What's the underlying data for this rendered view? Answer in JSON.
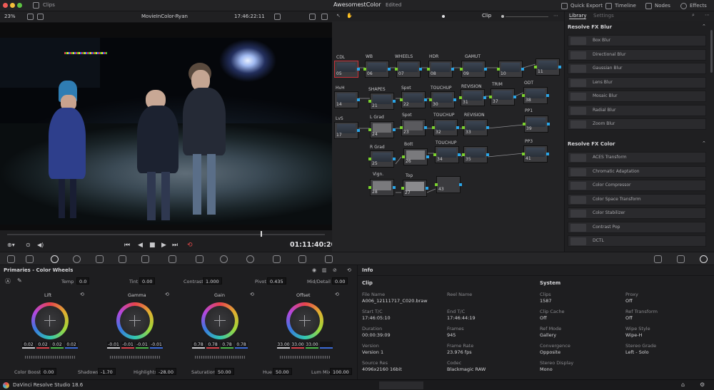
{
  "window": {
    "breadcrumb": "Clips",
    "project_title": "AwesomestColor",
    "project_status": "Edited",
    "top_buttons": {
      "quick_export": "Quick Export",
      "timeline": "Timeline",
      "nodes": "Nodes",
      "effects": "Effects"
    }
  },
  "viewer": {
    "zoom": "23%",
    "clip_name": "MovieInColor-Ryan",
    "timecode_top": "17:46:22:11",
    "timecode": "01:11:40:20"
  },
  "node_graph": {
    "mode": "Clip",
    "labels": [
      "CDL",
      "WB",
      "WHEELS",
      "HDR",
      "GAMUT",
      "HvH",
      "SHAPES",
      "Spot",
      "TOUCHUP",
      "REVISION",
      "TRIM",
      "ODT",
      "LvS",
      "L Grad",
      "Spot",
      "TOUCHUP",
      "REVISION",
      "PP1",
      "R Grad",
      "Bott",
      "TOUCHUP",
      "PP3",
      "Vign.",
      "Top"
    ],
    "node_numbers": [
      "05",
      "06",
      "07",
      "08",
      "09",
      "10",
      "11",
      "14",
      "21",
      "22",
      "30",
      "31",
      "37",
      "38",
      "17",
      "24",
      "23",
      "32",
      "33",
      "39",
      "25",
      "26",
      "34",
      "35",
      "41",
      "28",
      "27",
      "43"
    ]
  },
  "library": {
    "tabs": {
      "library": "Library",
      "settings": "Settings"
    },
    "section_blur": "Resolve FX Blur",
    "blur_items": [
      "Box Blur",
      "Directional Blur",
      "Gaussian Blur",
      "Lens Blur",
      "Mosaic Blur",
      "Radial Blur",
      "Zoom Blur"
    ],
    "section_color": "Resolve FX Color",
    "color_items": [
      "ACES Transform",
      "Chromatic Adaptation",
      "Color Compressor",
      "Color Space Transform",
      "Color Stabilizer",
      "Contrast Pop",
      "DCTL"
    ]
  },
  "color_wheels": {
    "title": "Primaries - Color Wheels",
    "top_params": [
      {
        "label": "Temp",
        "value": "0.0"
      },
      {
        "label": "Tint",
        "value": "0.00"
      },
      {
        "label": "Contrast",
        "value": "1.000"
      },
      {
        "label": "Pivot",
        "value": "0.435"
      },
      {
        "label": "Mid/Detail",
        "value": "0.00"
      }
    ],
    "wheels": [
      {
        "name": "Lift",
        "values": [
          "0.02",
          "0.02",
          "0.02",
          "0.02"
        ]
      },
      {
        "name": "Gamma",
        "values": [
          "-0.01",
          "-0.01",
          "-0.01",
          "-0.01"
        ]
      },
      {
        "name": "Gain",
        "values": [
          "0.78",
          "0.78",
          "0.78",
          "0.78"
        ]
      },
      {
        "name": "Offset",
        "values": [
          "33.00",
          "33.00",
          "33.00",
          ""
        ]
      }
    ],
    "bottom_params": [
      {
        "label": "Color Boost",
        "value": "0.00"
      },
      {
        "label": "Shadows",
        "value": "-1.70"
      },
      {
        "label": "Highlights",
        "value": "-28.00"
      },
      {
        "label": "Saturation",
        "value": "50.00"
      },
      {
        "label": "Hue",
        "value": "50.00"
      },
      {
        "label": "Lum Mix",
        "value": "100.00"
      }
    ]
  },
  "info_panel": {
    "title": "Info",
    "clip_heading": "Clip",
    "system_heading": "System",
    "clip_fields": [
      {
        "label": "File Name",
        "value": "A006_12111717_C020.braw"
      },
      {
        "label": "Reel Name",
        "value": ""
      },
      {
        "label": "Start T/C",
        "value": "17:46:05:10"
      },
      {
        "label": "End T/C",
        "value": "17:46:44:19"
      },
      {
        "label": "Duration",
        "value": "00:00:39:09"
      },
      {
        "label": "Frames",
        "value": "945"
      },
      {
        "label": "Version",
        "value": "Version 1"
      },
      {
        "label": "Frame Rate",
        "value": "23.976 fps"
      },
      {
        "label": "Source Res",
        "value": "4096x2160 16bit"
      },
      {
        "label": "Codec",
        "value": "Blackmagic RAW"
      }
    ],
    "system_fields": [
      {
        "label": "Clips",
        "value": "1587"
      },
      {
        "label": "Proxy",
        "value": "Off"
      },
      {
        "label": "Clip Cache",
        "value": "Off"
      },
      {
        "label": "Ref Transform",
        "value": "Off"
      },
      {
        "label": "Ref Mode",
        "value": "Gallery"
      },
      {
        "label": "Wipe Style",
        "value": "Wipe-H"
      },
      {
        "label": "Convergence",
        "value": "Opposite"
      },
      {
        "label": "Stereo Grade",
        "value": "Left - Solo"
      },
      {
        "label": "Stereo Display",
        "value": "Mono"
      }
    ]
  },
  "app_name": "DaVinci Resolve Studio 18.6"
}
